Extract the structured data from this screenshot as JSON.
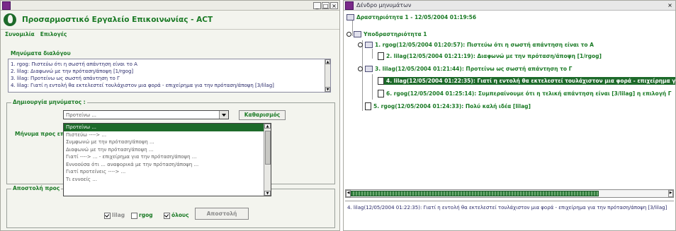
{
  "left_window": {
    "title": "",
    "app_title": "Προσαρμοστικό Εργαλείο Επικοινωνίας - ACT",
    "menu": [
      "Συνομιλία",
      "Επιλογές"
    ],
    "messages_label": "Μηνύματα διαλόγου",
    "messages": [
      "1. rgog:  Πιστεύω ότι η σωστή απάντηση είναι το Α",
      "2. lilag:  Διαφωνώ με την πρόταση/άποψη [1/rgog]",
      "3. lilag:  Προτείνω ως σωστή απάντηση το Γ",
      "4. lilag:  Γιατί η εντολή θα εκτελεστεί τουλάχιστον μια φορά  - επιχείρημα για την πρόταση/άποψη [3/lilag]"
    ],
    "compose_label": "Δημιουργία μηνύματος :",
    "combo_value": "Προτείνω ...",
    "clear_button": "Καθαρισμός",
    "message_to_label": "Μήνυμα προς επ",
    "dropdown_items": [
      "Προτείνω ...",
      "Πιστεύω ----> ...",
      "Συμφωνώ με την πρόταση/άποψη ...",
      "Διαφωνώ με την πρόταση/άποψη ...",
      "Γιατί ----> ... - επιχείρημα για την πρόταση/άποψη ...",
      "Εννοούσα ότι ... αναφορικά με την πρόταση/άποψη ...",
      "Γιατί προτείνεις ----> ...",
      "Τι εννοείς ..."
    ],
    "dropdown_selected_index": 0,
    "send_to_label": "Αποστολή προς",
    "recipients": [
      {
        "name": "lilag",
        "checked": true
      },
      {
        "name": "rgog",
        "checked": false
      },
      {
        "name": "όλους",
        "checked": true
      }
    ],
    "send_button": "Αποστολή"
  },
  "right_window": {
    "title": "Δένδρο μηνυμάτων",
    "nodes": [
      {
        "label": "Δραστηριότητα 1 - 12/05/2004 01:19:56",
        "kind": "folder"
      },
      {
        "label": "Υποδραστηριότητα 1",
        "kind": "folder"
      },
      {
        "label": "1. rgog(12/05/2004 01:20:57):  Πιστεύω ότι η σωστή απάντηση είναι το Α",
        "kind": "folder"
      },
      {
        "label": "2. lilag(12/05/2004 01:21:19):  Διαφωνώ με την πρόταση/άποψη [1/rgog]",
        "kind": "doc"
      },
      {
        "label": "3. lilag(12/05/2004 01:21:44):  Προτείνω ως σωστή απάντηση το Γ",
        "kind": "folder"
      },
      {
        "label": "4. lilag(12/05/2004 01:22:35):  Γιατί η εντολή θα εκτελεστεί τουλάχιστον μια φορά  - επιχείρημα γ",
        "kind": "doc"
      },
      {
        "label": "6. rgog(12/05/2004 01:25:14):  Συμπεραίνουμε ότι η τελική απάντηση είναι [3/lilag] η επιλογή Γ",
        "kind": "doc"
      },
      {
        "label": "5. rgog(12/05/2004 01:24:33):  Πολύ καλή ιδέα [lilag]",
        "kind": "doc"
      }
    ],
    "selected_node_index": 5,
    "detail_text": "4. lilag(12/05/2004 01:22:35):  Γιατί η εντολή θα εκτελεστεί τουλάχιστον μια φορά  - επιχείρημα για την πρόταση/άποψη [3/lilag]"
  },
  "colors": {
    "accent": "#1a7a25",
    "selection": "#1d6a2a",
    "link_text": "#2a2a6a"
  },
  "icons": [
    "app-icon",
    "minimize-icon",
    "maximize-icon",
    "close-icon",
    "folder-icon",
    "document-icon",
    "pin-icon",
    "chevron-down-icon"
  ]
}
